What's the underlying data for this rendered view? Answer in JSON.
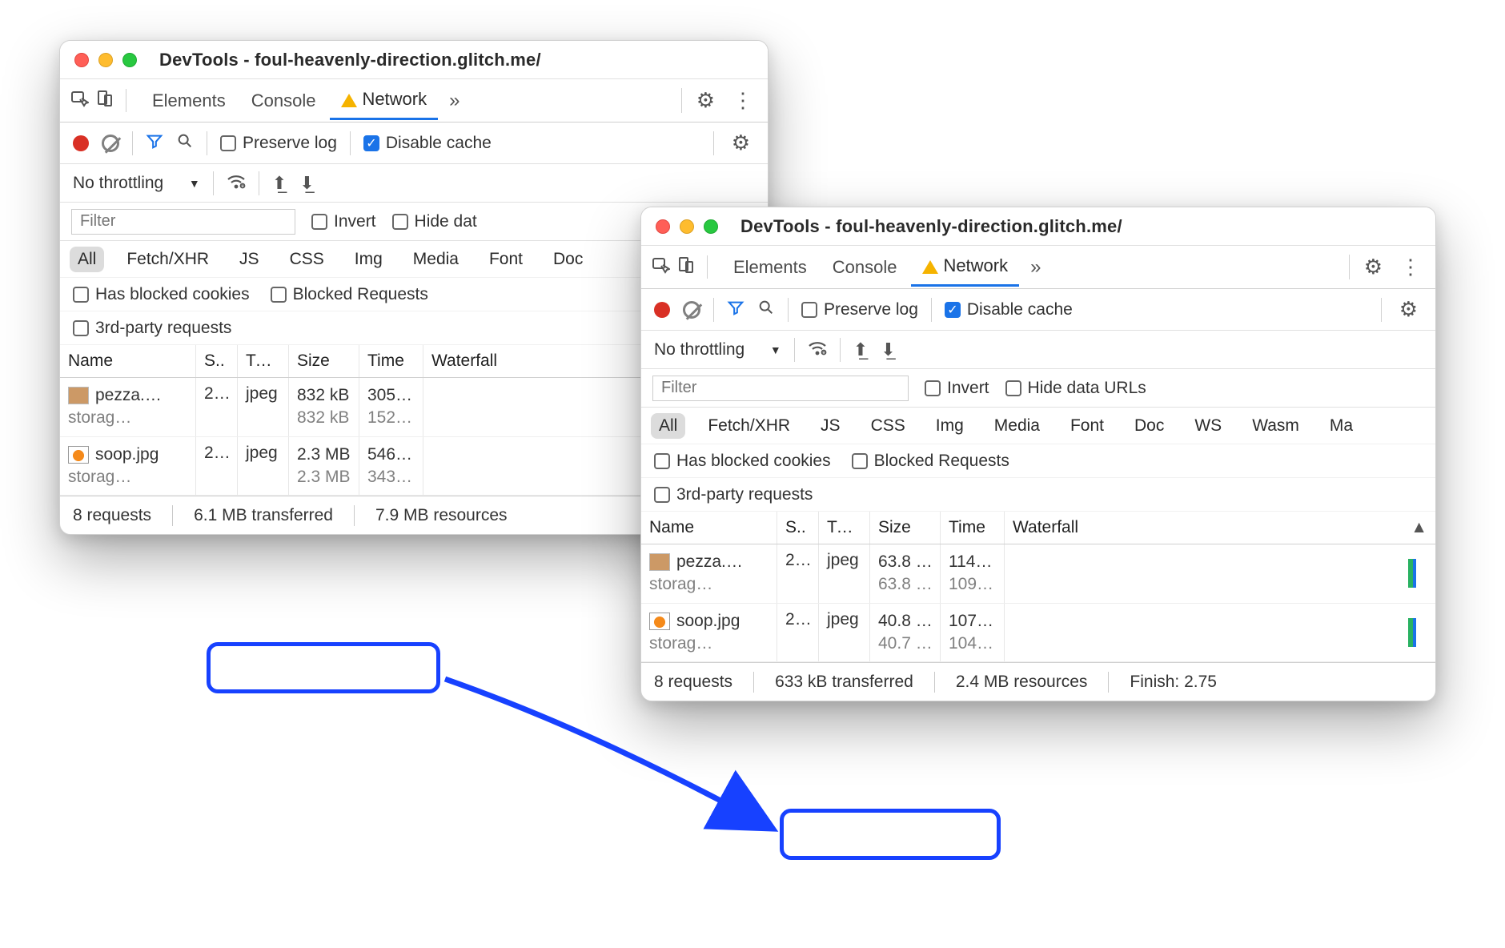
{
  "left": {
    "title": "DevTools - foul-heavenly-direction.glitch.me/",
    "tabs": {
      "elements": "Elements",
      "console": "Console",
      "network": "Network"
    },
    "toolbar": {
      "preserve_log": "Preserve log",
      "disable_cache": "Disable cache"
    },
    "throttle": {
      "label": "No throttling"
    },
    "filter": {
      "placeholder": "Filter",
      "invert": "Invert",
      "hide_data": "Hide dat"
    },
    "chips": [
      "All",
      "Fetch/XHR",
      "JS",
      "CSS",
      "Img",
      "Media",
      "Font",
      "Doc"
    ],
    "extra": {
      "blocked_cookies": "Has blocked cookies",
      "blocked_requests": "Blocked Requests",
      "third_party": "3rd-party requests"
    },
    "headers": {
      "name": "Name",
      "status": "S..",
      "type": "Type",
      "size": "Size",
      "time": "Time",
      "waterfall": "Waterfall"
    },
    "rows": [
      {
        "thumb": "pizza",
        "name": "pezza.…",
        "sub": "storag…",
        "status": "2…",
        "type": "jpeg",
        "size_top": "832 kB",
        "size_sub": "832 kB",
        "time_top": "305…",
        "time_sub": "152…"
      },
      {
        "thumb": "soup",
        "name": "soop.jpg",
        "sub": "storag…",
        "status": "2…",
        "type": "jpeg",
        "size_top": "2.3 MB",
        "size_sub": "2.3 MB",
        "time_top": "546…",
        "time_sub": "343…"
      }
    ],
    "status": {
      "requests": "8 requests",
      "transferred": "6.1 MB transferred",
      "resources": "7.9 MB resources"
    }
  },
  "right": {
    "title": "DevTools - foul-heavenly-direction.glitch.me/",
    "tabs": {
      "elements": "Elements",
      "console": "Console",
      "network": "Network"
    },
    "toolbar": {
      "preserve_log": "Preserve log",
      "disable_cache": "Disable cache"
    },
    "throttle": {
      "label": "No throttling"
    },
    "filter": {
      "placeholder": "Filter",
      "invert": "Invert",
      "hide_data": "Hide data URLs"
    },
    "chips": [
      "All",
      "Fetch/XHR",
      "JS",
      "CSS",
      "Img",
      "Media",
      "Font",
      "Doc",
      "WS",
      "Wasm",
      "Ma"
    ],
    "extra": {
      "blocked_cookies": "Has blocked cookies",
      "blocked_requests": "Blocked Requests",
      "third_party": "3rd-party requests"
    },
    "headers": {
      "name": "Name",
      "status": "S..",
      "type": "Type",
      "size": "Size",
      "time": "Time",
      "waterfall": "Waterfall"
    },
    "rows": [
      {
        "thumb": "pizza",
        "name": "pezza.…",
        "sub": "storag…",
        "status": "2…",
        "type": "jpeg",
        "size_top": "63.8 …",
        "size_sub": "63.8 …",
        "time_top": "114…",
        "time_sub": "109…"
      },
      {
        "thumb": "soup",
        "name": "soop.jpg",
        "sub": "storag…",
        "status": "2…",
        "type": "jpeg",
        "size_top": "40.8 …",
        "size_sub": "40.7 …",
        "time_top": "107…",
        "time_sub": "104…"
      }
    ],
    "status": {
      "requests": "8 requests",
      "transferred": "633 kB transferred",
      "resources": "2.4 MB resources",
      "finish": "Finish: 2.75"
    }
  }
}
